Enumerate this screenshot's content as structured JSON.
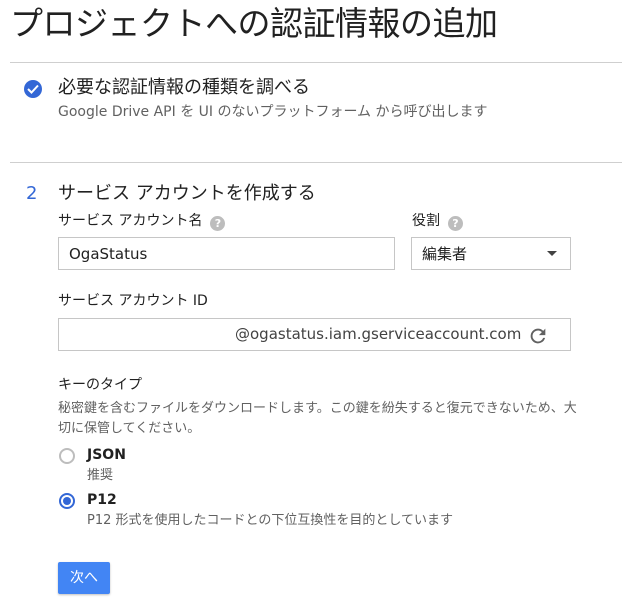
{
  "header": {
    "title": "プロジェクトへの認証情報の追加"
  },
  "step1": {
    "title": "必要な認証情報の種類を調べる",
    "description": "Google Drive API を UI のないプラットフォーム から呼び出します",
    "completed_icon": "check-circle-icon"
  },
  "step2": {
    "number": "2",
    "title": "サービス アカウントを作成する",
    "account_name_label": "サービス アカウント名",
    "account_name_value": "OgaStatus",
    "role_label": "役割",
    "role_value": "編集者",
    "account_id_label": "サービス アカウント ID",
    "account_id_value": "",
    "account_id_suffix": "@ogastatus.iam.gserviceaccount.com",
    "help_glyph": "?",
    "key_type_label": "キーのタイプ",
    "key_type_description": "秘密鍵を含むファイルをダウンロードします。この鍵を紛失すると復元できないため、大切に保管してください。",
    "key_options": [
      {
        "label": "JSON",
        "description": "推奨",
        "selected": false
      },
      {
        "label": "P12",
        "description": "P12 形式を使用したコードとの下位互換性を目的としています",
        "selected": true
      }
    ],
    "next_label": "次へ"
  },
  "colors": {
    "accent": "#3367d6",
    "button": "#4285f4",
    "divider": "#cfcfcf"
  }
}
